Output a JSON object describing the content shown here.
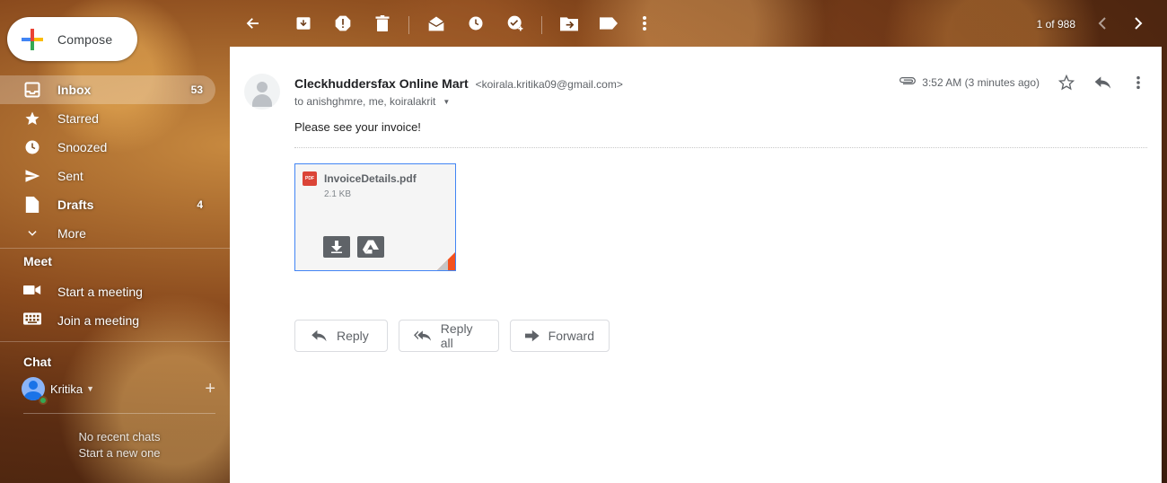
{
  "compose": {
    "label": "Compose"
  },
  "nav": [
    {
      "label": "Inbox",
      "count": "53",
      "icon": "inbox-icon",
      "active": true
    },
    {
      "label": "Starred",
      "count": "",
      "icon": "star-icon"
    },
    {
      "label": "Snoozed",
      "count": "",
      "icon": "clock-icon"
    },
    {
      "label": "Sent",
      "count": "",
      "icon": "send-icon"
    },
    {
      "label": "Drafts",
      "count": "4",
      "icon": "draft-icon"
    },
    {
      "label": "More",
      "count": "",
      "icon": "chevron-down-icon"
    }
  ],
  "meet": {
    "title": "Meet",
    "start": "Start a meeting",
    "join": "Join a meeting"
  },
  "chat": {
    "title": "Chat",
    "user": "Kritika",
    "empty_line1": "No recent chats",
    "empty_line2": "Start a new one"
  },
  "toolbar": {
    "pager": "1 of 988"
  },
  "email": {
    "sender_name": "Cleckhuddersfax Online Mart",
    "sender_email": "<koirala.kritika09@gmail.com>",
    "to": "to anishghmre, me, koiralakrit",
    "time": "3:52 AM (3 minutes ago)",
    "body": "Please see your invoice!",
    "attachment": {
      "badge": "PDF",
      "name": "InvoiceDetails.pdf",
      "size": "2.1 KB"
    },
    "reply_label": "Reply",
    "reply_all_label": "Reply all",
    "forward_label": "Forward"
  },
  "colors": {
    "accent": "#4285f4",
    "pdf_red": "#db4437",
    "corner_orange": "#f4511e"
  }
}
